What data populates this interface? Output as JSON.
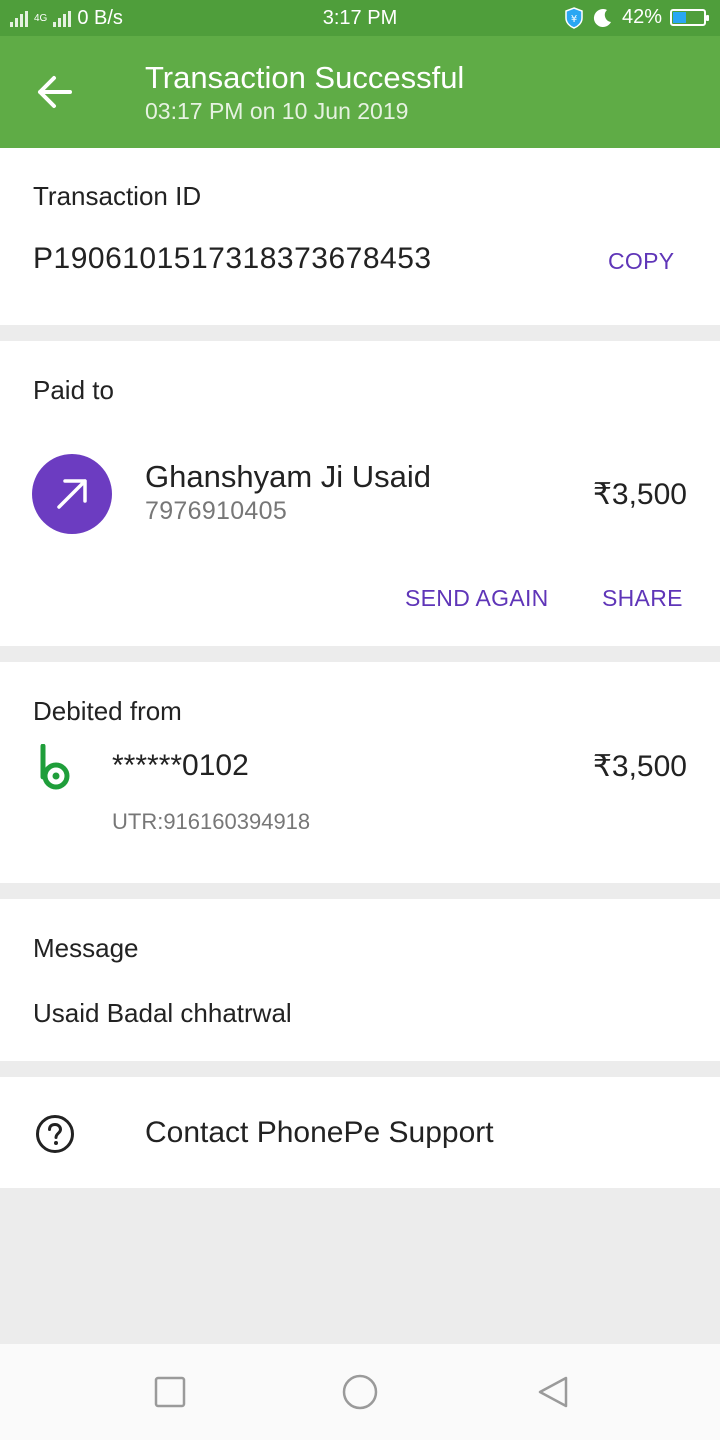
{
  "status_bar": {
    "network_label": "4G",
    "speed": "0 B/s",
    "time": "3:17 PM",
    "battery": "42%",
    "battery_level": 0.42
  },
  "app_bar": {
    "title": "Transaction Successful",
    "subtitle": "03:17 PM on 10 Jun 2019",
    "background_color": "#5fac46"
  },
  "transaction": {
    "label": "Transaction ID",
    "id": "P1906101517318373678453",
    "copy_label": "COPY"
  },
  "paid_to": {
    "label": "Paid to",
    "name": "Ghanshyam Ji Usaid",
    "phone": "7976910405",
    "amount": "₹3,500",
    "send_again_label": "SEND AGAIN",
    "share_label": "SHARE",
    "avatar_icon": "arrow-up-right-icon",
    "avatar_color": "#6c3cc1"
  },
  "debited_from": {
    "label": "Debited from",
    "account": "******0102",
    "amount": "₹3,500",
    "utr": "UTR:916160394918",
    "bank_icon": "bank-logo-icon"
  },
  "message": {
    "label": "Message",
    "text": "Usaid Badal chhatrwal"
  },
  "support": {
    "label": "Contact PhonePe Support",
    "icon": "help-circle-icon"
  },
  "accent_color": "#5f35b8"
}
